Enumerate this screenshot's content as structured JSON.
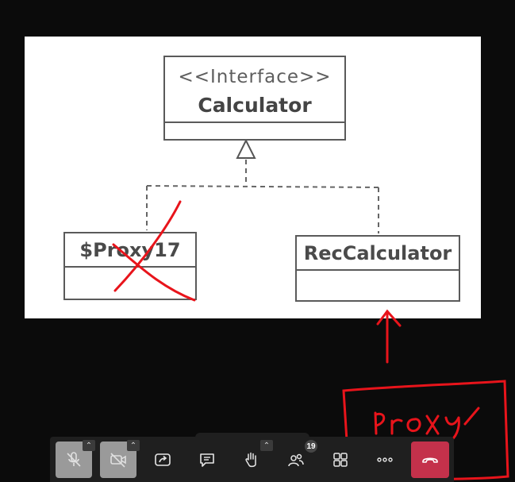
{
  "slide": {
    "interface_box": {
      "stereotype": "<<Interface>>",
      "name": "Calculator"
    },
    "proxy_box": {
      "name": "$Proxy17"
    },
    "rec_box": {
      "name": "RecCalculator"
    }
  },
  "annotations": {
    "handwritten_label": "proxy",
    "ink_color": "#e8141b"
  },
  "toolbar": {
    "participant_count": "19",
    "buttons": [
      {
        "name": "mic-muted",
        "icon": "mic-off-icon",
        "state": "muted"
      },
      {
        "name": "camera-off",
        "icon": "camera-off-icon",
        "state": "off"
      },
      {
        "name": "share-screen",
        "icon": "share-screen-icon"
      },
      {
        "name": "chat",
        "icon": "chat-icon"
      },
      {
        "name": "raise-hand",
        "icon": "hand-icon"
      },
      {
        "name": "participants",
        "icon": "people-icon"
      },
      {
        "name": "apps",
        "icon": "apps-grid-icon"
      },
      {
        "name": "more",
        "icon": "more-icon"
      },
      {
        "name": "leave-call",
        "icon": "hang-up-icon"
      }
    ],
    "colors": {
      "bar": "#1f1f1f",
      "muted_bg": "#9a9a9a",
      "leave_bg": "#c4314b"
    }
  }
}
